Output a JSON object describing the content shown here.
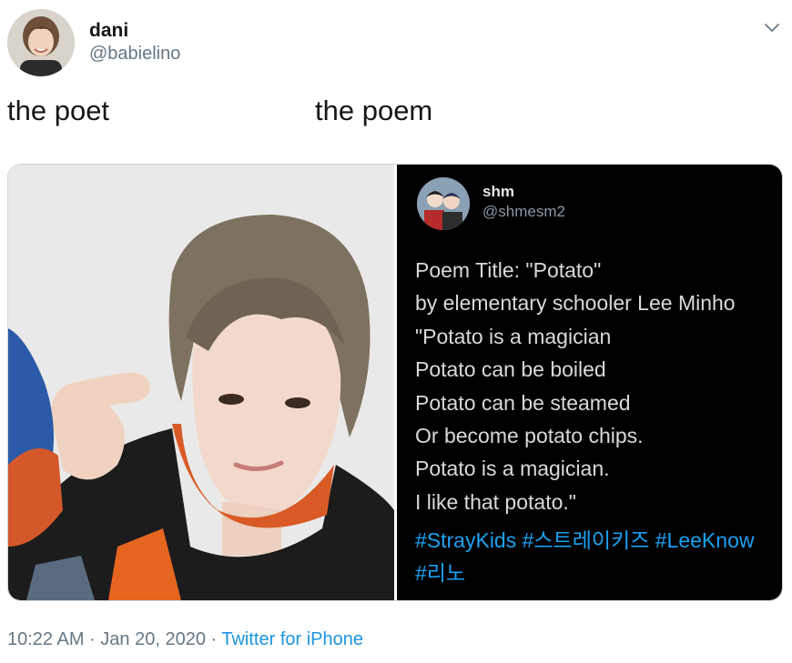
{
  "user": {
    "display_name": "dani",
    "handle": "@babielino",
    "avatar_icon": "profile-photo"
  },
  "menu_icon": "chevron-down-icon",
  "tweet": {
    "text_left": "the poet",
    "text_right": "the poem"
  },
  "embedded": {
    "name": "shm",
    "handle": "@shmesm2",
    "poem_lines": [
      "Poem Title: \"Potato\"",
      "by elementary schooler Lee Minho",
      "\"Potato is a magician",
      "Potato can be boiled",
      "Potato can be steamed",
      "Or become potato chips.",
      "Potato is a magician.",
      "I like that potato.\""
    ],
    "hashtags_line1": [
      "#StrayKids",
      "#스트레이키즈",
      "#LeeKnow"
    ],
    "hashtags_line2": [
      "#리노"
    ]
  },
  "meta": {
    "time": "10:22 AM",
    "sep1": " · ",
    "date": "Jan 20, 2020",
    "sep2": " · ",
    "source": "Twitter for iPhone"
  },
  "colors": {
    "link": "#1da1f2",
    "muted": "#657786",
    "text": "#14171a"
  }
}
